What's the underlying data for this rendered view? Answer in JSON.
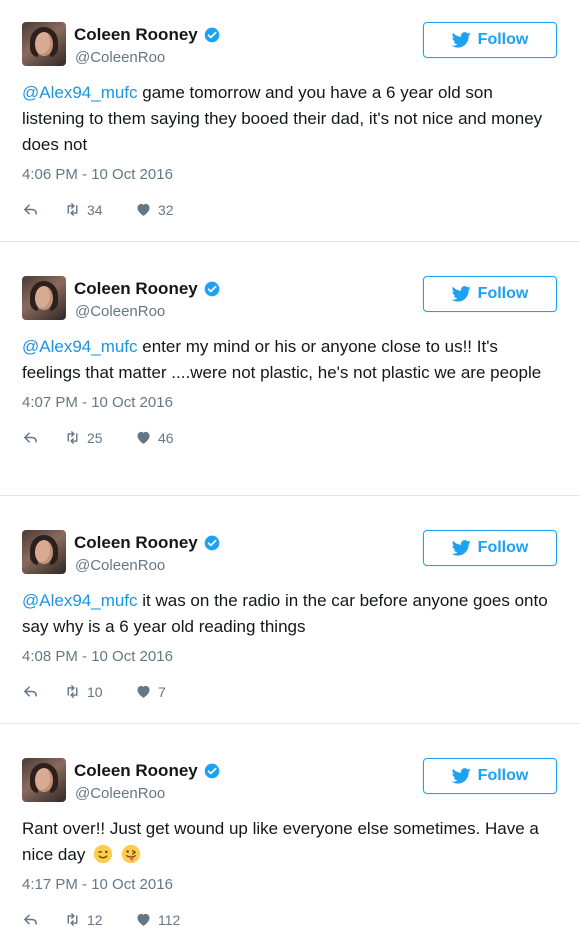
{
  "colors": {
    "accent": "#1da1f2",
    "link": "#1b95e0",
    "text": "#14171a",
    "muted": "#657786",
    "divider": "#e1e8ed"
  },
  "icons": {
    "verified": "verified-icon",
    "follow": "twitter-bird-icon",
    "reply": "reply-icon",
    "retweet": "retweet-icon",
    "like": "heart-icon",
    "emoji_1": "winking-face-emoji",
    "emoji_2": "face-with-tongue-emoji"
  },
  "tweets": [
    {
      "name": "Coleen Rooney",
      "handle": "@ColeenRoo",
      "follow_label": "Follow",
      "mention": "@Alex94_mufc",
      "text": " game tomorrow and you have a 6 year old son listening to them saying they booed their dad, it's not nice and money does not",
      "timestamp": "4:06 PM - 10 Oct 2016",
      "retweets": "34",
      "likes": "32"
    },
    {
      "name": "Coleen Rooney",
      "handle": "@ColeenRoo",
      "follow_label": "Follow",
      "mention": "@Alex94_mufc",
      "text": " enter my mind or his or anyone close to us!! It's feelings that matter ....were not plastic, he's not plastic we are people",
      "timestamp": "4:07 PM - 10 Oct 2016",
      "retweets": "25",
      "likes": "46"
    },
    {
      "name": "Coleen Rooney",
      "handle": "@ColeenRoo",
      "follow_label": "Follow",
      "mention": "@Alex94_mufc",
      "text": " it was on the radio in the car before anyone goes onto say why is a 6 year old reading things",
      "timestamp": "4:08 PM - 10 Oct 2016",
      "retweets": "10",
      "likes": "7"
    },
    {
      "name": "Coleen Rooney",
      "handle": "@ColeenRoo",
      "follow_label": "Follow",
      "mention": "",
      "text": "Rant over!! Just get wound up like everyone else sometimes. Have a nice day",
      "timestamp": "4:17 PM - 10 Oct 2016",
      "retweets": "12",
      "likes": "112"
    }
  ]
}
